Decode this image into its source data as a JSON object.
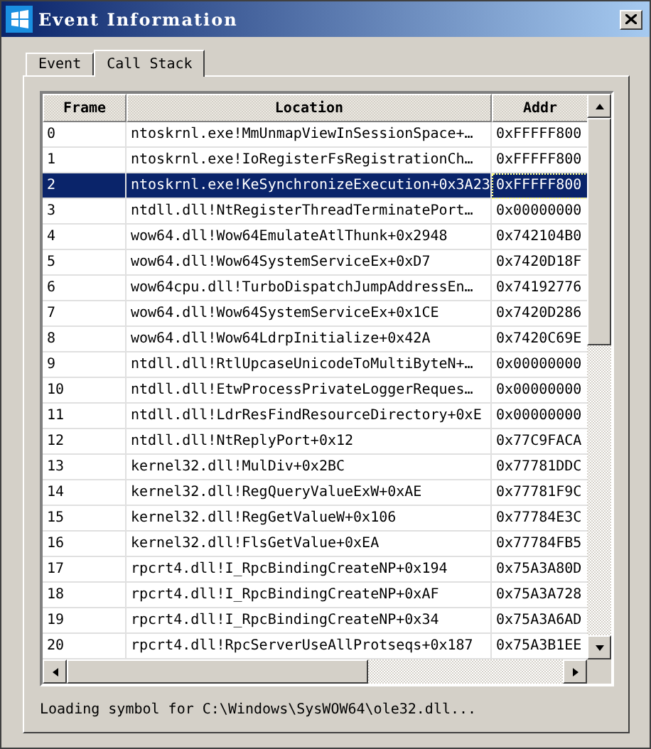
{
  "window": {
    "title": "Event Information"
  },
  "tabs": [
    {
      "label": "Event",
      "selected": false
    },
    {
      "label": "Call Stack",
      "selected": true
    }
  ],
  "table": {
    "columns": [
      "Frame",
      "Location",
      "Addr"
    ],
    "rows": [
      {
        "frame": "0",
        "location": "ntoskrnl.exe!MmUnmapViewInSessionSpace+…",
        "address": "0xFFFFF800",
        "selected": false
      },
      {
        "frame": "1",
        "location": "ntoskrnl.exe!IoRegisterFsRegistrationCh…",
        "address": "0xFFFFF800",
        "selected": false
      },
      {
        "frame": "2",
        "location": "ntoskrnl.exe!KeSynchronizeExecution+0x3A23",
        "address": "0xFFFFF800",
        "selected": true
      },
      {
        "frame": "3",
        "location": "ntdll.dll!NtRegisterThreadTerminatePort…",
        "address": "0x00000000",
        "selected": false
      },
      {
        "frame": "4",
        "location": "wow64.dll!Wow64EmulateAtlThunk+0x2948",
        "address": "0x742104B0",
        "selected": false
      },
      {
        "frame": "5",
        "location": "wow64.dll!Wow64SystemServiceEx+0xD7",
        "address": "0x7420D18F",
        "selected": false
      },
      {
        "frame": "6",
        "location": "wow64cpu.dll!TurboDispatchJumpAddressEn…",
        "address": "0x74192776",
        "selected": false
      },
      {
        "frame": "7",
        "location": "wow64.dll!Wow64SystemServiceEx+0x1CE",
        "address": "0x7420D286",
        "selected": false
      },
      {
        "frame": "8",
        "location": "wow64.dll!Wow64LdrpInitialize+0x42A",
        "address": "0x7420C69E",
        "selected": false
      },
      {
        "frame": "9",
        "location": "ntdll.dll!RtlUpcaseUnicodeToMultiByteN+…",
        "address": "0x00000000",
        "selected": false
      },
      {
        "frame": "10",
        "location": "ntdll.dll!EtwProcessPrivateLoggerReques…",
        "address": "0x00000000",
        "selected": false
      },
      {
        "frame": "11",
        "location": "ntdll.dll!LdrResFindResourceDirectory+0xE",
        "address": "0x00000000",
        "selected": false
      },
      {
        "frame": "12",
        "location": "ntdll.dll!NtReplyPort+0x12",
        "address": "0x77C9FACA",
        "selected": false
      },
      {
        "frame": "13",
        "location": "kernel32.dll!MulDiv+0x2BC",
        "address": "0x77781DDC",
        "selected": false
      },
      {
        "frame": "14",
        "location": "kernel32.dll!RegQueryValueExW+0xAE",
        "address": "0x77781F9C",
        "selected": false
      },
      {
        "frame": "15",
        "location": "kernel32.dll!RegGetValueW+0x106",
        "address": "0x77784E3C",
        "selected": false
      },
      {
        "frame": "16",
        "location": "kernel32.dll!FlsGetValue+0xEA",
        "address": "0x77784FB5",
        "selected": false
      },
      {
        "frame": "17",
        "location": "rpcrt4.dll!I_RpcBindingCreateNP+0x194",
        "address": "0x75A3A80D",
        "selected": false
      },
      {
        "frame": "18",
        "location": "rpcrt4.dll!I_RpcBindingCreateNP+0xAF",
        "address": "0x75A3A728",
        "selected": false
      },
      {
        "frame": "19",
        "location": "rpcrt4.dll!I_RpcBindingCreateNP+0x34",
        "address": "0x75A3A6AD",
        "selected": false
      },
      {
        "frame": "20",
        "location": "rpcrt4.dll!RpcServerUseAllProtseqs+0x187",
        "address": "0x75A3B1EE",
        "selected": false
      }
    ]
  },
  "status_text": "Loading symbol for C:\\Windows\\SysWOW64\\ole32.dll..."
}
